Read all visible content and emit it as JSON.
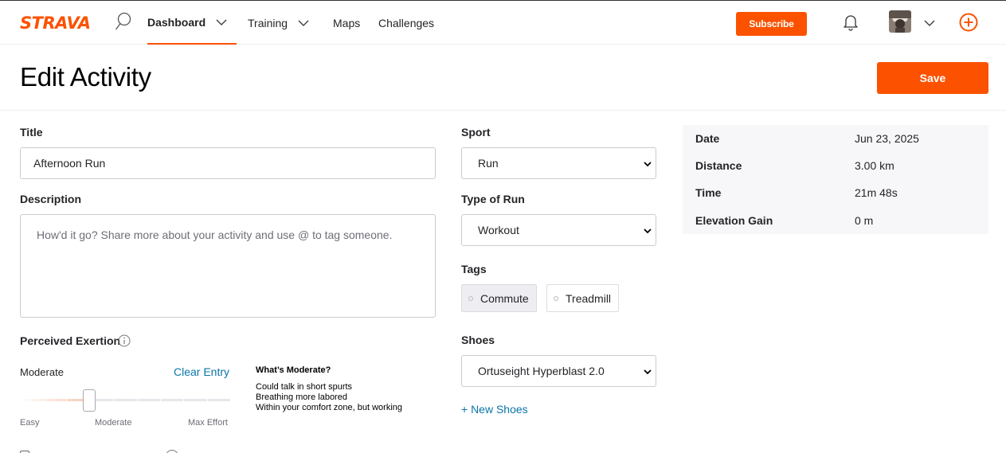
{
  "nav": {
    "logo": "STRAVA",
    "items": [
      {
        "label": "Dashboard"
      },
      {
        "label": "Training"
      },
      {
        "label": "Maps"
      },
      {
        "label": "Challenges"
      }
    ],
    "subscribe_label": "Subscribe"
  },
  "header": {
    "title": "Edit Activity",
    "save_label": "Save"
  },
  "form": {
    "title_label": "Title",
    "title_value": "Afternoon Run",
    "description_label": "Description",
    "description_placeholder": "How'd it go? Share more about your activity and use @ to tag someone.",
    "perceived_label": "Perceived Exertion",
    "exertion_level": "Moderate",
    "clear_entry": "Clear Entry",
    "slider": {
      "level_fraction": 0.33,
      "min_label": "Easy",
      "mid_label": "Moderate",
      "max_label": "Max Effort"
    },
    "moderate_info": {
      "title": "What’s Moderate?",
      "lines": [
        "Could talk in short spurts",
        "Breathing more labored",
        "Within your comfort zone, but working"
      ]
    },
    "sport_label": "Sport",
    "sport_value": "Run",
    "type_label": "Type of Run",
    "type_value": "Workout",
    "tags_label": "Tags",
    "tags": [
      {
        "label": "Commute",
        "selected": true
      },
      {
        "label": "Treadmill",
        "selected": false
      }
    ],
    "shoes_label": "Shoes",
    "shoes_value": "Ortuseight Hyperblast 2.0",
    "new_shoes": "+ New Shoes"
  },
  "stats": [
    {
      "key": "Date",
      "value": "Jun 23, 2025"
    },
    {
      "key": "Distance",
      "value": "3.00 km"
    },
    {
      "key": "Time",
      "value": "21m 48s"
    },
    {
      "key": "Elevation Gain",
      "value": "0 m"
    }
  ],
  "colors": {
    "brand": "#fc5200",
    "link": "#0a75a8"
  }
}
